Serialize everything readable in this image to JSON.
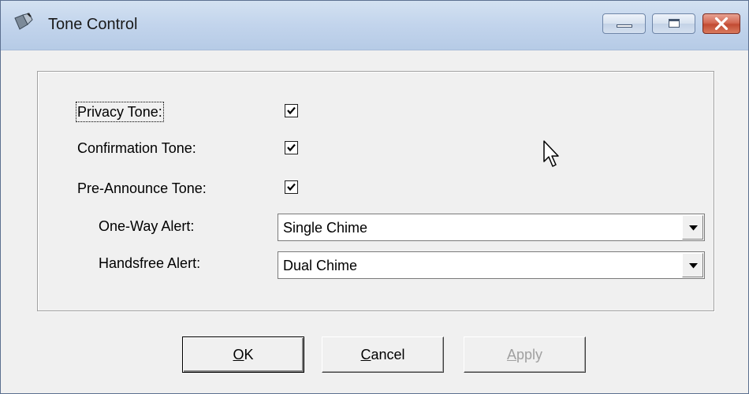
{
  "window": {
    "title": "Tone Control",
    "icon": "tone-control-app-icon"
  },
  "title_buttons": {
    "minimize": "minimize-icon",
    "maximize": "maximize-icon",
    "close": "close-icon"
  },
  "options": {
    "privacy_tone": {
      "label": "Privacy Tone:",
      "checked": true
    },
    "confirmation_tone": {
      "label": "Confirmation Tone:",
      "checked": true
    },
    "pre_announce_tone": {
      "label": "Pre-Announce Tone:",
      "checked": true
    }
  },
  "alerts": {
    "one_way": {
      "label": "One-Way Alert:",
      "value": "Single Chime"
    },
    "handsfree": {
      "label": "Handsfree Alert:",
      "value": "Dual Chime"
    }
  },
  "buttons": {
    "ok": {
      "mnemonic": "O",
      "rest": "K"
    },
    "cancel": {
      "mnemonic": "C",
      "rest": "ancel"
    },
    "apply": {
      "mnemonic": "A",
      "rest": "pply",
      "enabled": false
    }
  },
  "colors": {
    "titlebar": "#c2d4ec",
    "close_button": "#c24b33",
    "dialog_background": "#f0f0f0",
    "disabled_text": "#a0a0a0"
  }
}
